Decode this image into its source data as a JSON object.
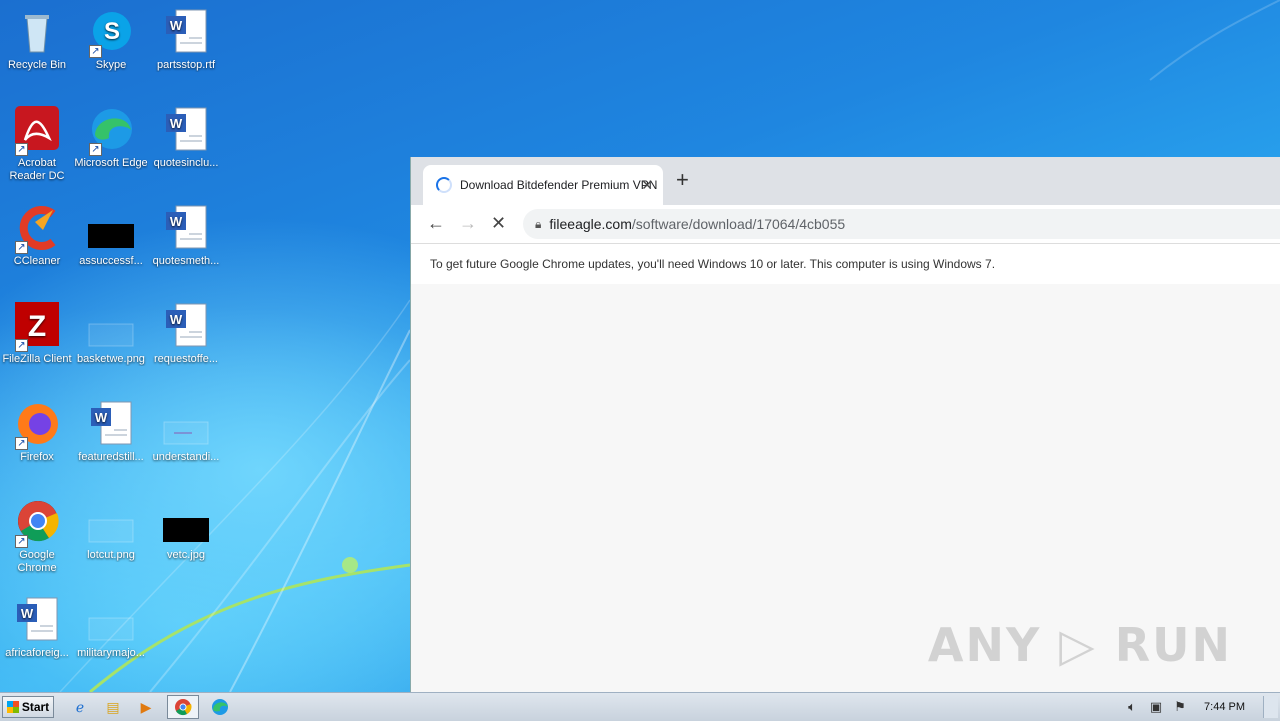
{
  "desktop": {
    "icons": [
      {
        "label": "Recycle Bin",
        "icon": "recycle-bin-icon"
      },
      {
        "label": "Skype",
        "icon": "skype-icon"
      },
      {
        "label": "partsstop.rtf",
        "icon": "word-document-icon"
      },
      {
        "label": "Acrobat Reader DC",
        "icon": "acrobat-icon"
      },
      {
        "label": "Microsoft Edge",
        "icon": "edge-icon"
      },
      {
        "label": "quotesinclu...",
        "icon": "word-document-icon"
      },
      {
        "label": "CCleaner",
        "icon": "ccleaner-icon"
      },
      {
        "label": "assuccessf...",
        "icon": "black-image-thumbnail-icon"
      },
      {
        "label": "quotesmeth...",
        "icon": "word-document-icon"
      },
      {
        "label": "FileZilla Client",
        "icon": "filezilla-icon"
      },
      {
        "label": "basketwe.png",
        "icon": "image-thumbnail-icon"
      },
      {
        "label": "requestoffe...",
        "icon": "word-document-icon"
      },
      {
        "label": "Firefox",
        "icon": "firefox-icon"
      },
      {
        "label": "featuredstill...",
        "icon": "word-document-icon"
      },
      {
        "label": "understandi...",
        "icon": "image-thumbnail-icon"
      },
      {
        "label": "Google Chrome",
        "icon": "chrome-icon"
      },
      {
        "label": "lotcut.png",
        "icon": "image-thumbnail-icon"
      },
      {
        "label": "vetc.jpg",
        "icon": "black-image-thumbnail-icon"
      },
      {
        "label": "africaforeig...",
        "icon": "word-document-icon"
      },
      {
        "label": "militarymajo...",
        "icon": "image-thumbnail-icon"
      }
    ]
  },
  "browser": {
    "tab_title": "Download Bitdefender Premium VPN",
    "url_host": "fileeagle.com",
    "url_path": "/software/download/17064/4cb055",
    "infobar_text": "To get future Google Chrome updates, you'll need Windows 10 or later. This computer is using Windows 7."
  },
  "watermark": "ANY ▷ RUN",
  "taskbar": {
    "start_label": "Start",
    "clock": "7:44 PM"
  },
  "colors": {
    "accent": "#1a73e8",
    "tabstrip": "#dee1e6"
  }
}
